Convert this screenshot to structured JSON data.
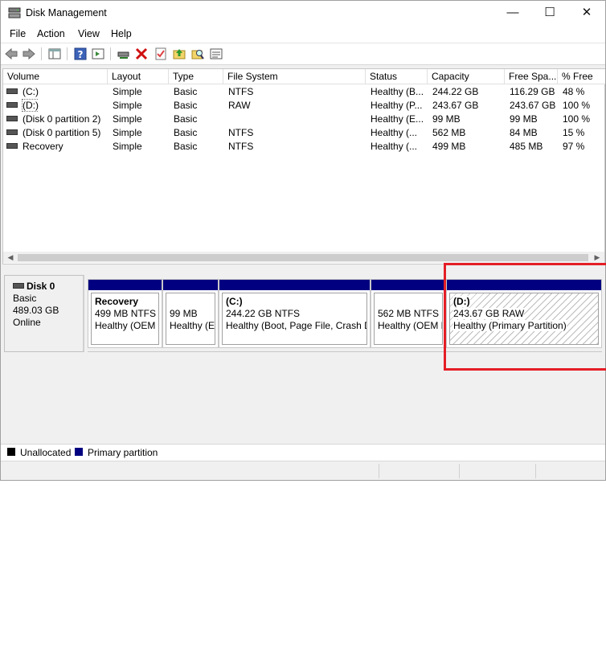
{
  "window": {
    "title": "Disk Management",
    "minimize": "—",
    "maximize": "☐",
    "close": "✕"
  },
  "menu": [
    "File",
    "Action",
    "View",
    "Help"
  ],
  "table": {
    "columns": [
      "Volume",
      "Layout",
      "Type",
      "File System",
      "Status",
      "Capacity",
      "Free Spa...",
      "% Free"
    ],
    "rows": [
      [
        "(C:)",
        "Simple",
        "Basic",
        "NTFS",
        "Healthy (B...",
        "244.22 GB",
        "116.29 GB",
        "48 %"
      ],
      [
        "(D:)",
        "Simple",
        "Basic",
        "RAW",
        "Healthy (P...",
        "243.67 GB",
        "243.67 GB",
        "100 %"
      ],
      [
        "(Disk 0 partition 2)",
        "Simple",
        "Basic",
        "",
        "Healthy (E...",
        "99 MB",
        "99 MB",
        "100 %"
      ],
      [
        "(Disk 0 partition 5)",
        "Simple",
        "Basic",
        "NTFS",
        "Healthy (...",
        "562 MB",
        "84 MB",
        "15 %"
      ],
      [
        "Recovery",
        "Simple",
        "Basic",
        "NTFS",
        "Healthy (...",
        "499 MB",
        "485 MB",
        "97 %"
      ]
    ]
  },
  "disk": {
    "name": "Disk 0",
    "type": "Basic",
    "size": "489.03 GB",
    "state": "Online"
  },
  "partitions": [
    {
      "name": "Recovery",
      "size": "499 MB NTFS",
      "status": "Healthy (OEM"
    },
    {
      "name": "",
      "size": "99 MB",
      "status": "Healthy (E"
    },
    {
      "name": "(C:)",
      "size": "244.22 GB NTFS",
      "status": "Healthy (Boot, Page File, Crash D"
    },
    {
      "name": "",
      "size": "562 MB NTFS",
      "status": "Healthy (OEM F"
    },
    {
      "name": "(D:)",
      "size": "243.67 GB RAW",
      "status": "Healthy (Primary Partition)"
    }
  ],
  "legend": {
    "unallocated": "Unallocated",
    "primary": "Primary partition"
  },
  "colors": {
    "primary": "#000080",
    "unallocated": "#000000",
    "highlight": "#e41e26"
  }
}
